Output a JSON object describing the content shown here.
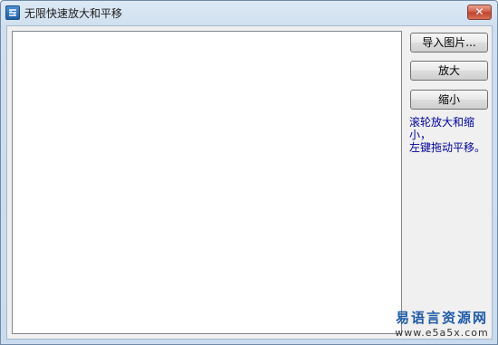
{
  "window": {
    "title": "无限快速放大和平移",
    "icon": "app-logo-icon",
    "close_label": "✕"
  },
  "sidebar": {
    "import_button": "导入图片...",
    "zoom_in_button": "放大",
    "zoom_out_button": "缩小",
    "hint_line1": "滚轮放大和缩小，",
    "hint_line2": "左键拖动平移。"
  },
  "watermark": {
    "chinese": "易语言资源网",
    "url": "www.e5a5x.com"
  },
  "colors": {
    "hint_text": "#0000a0",
    "watermark_text": "#1e5aa8",
    "close_button": "#c0412a"
  }
}
